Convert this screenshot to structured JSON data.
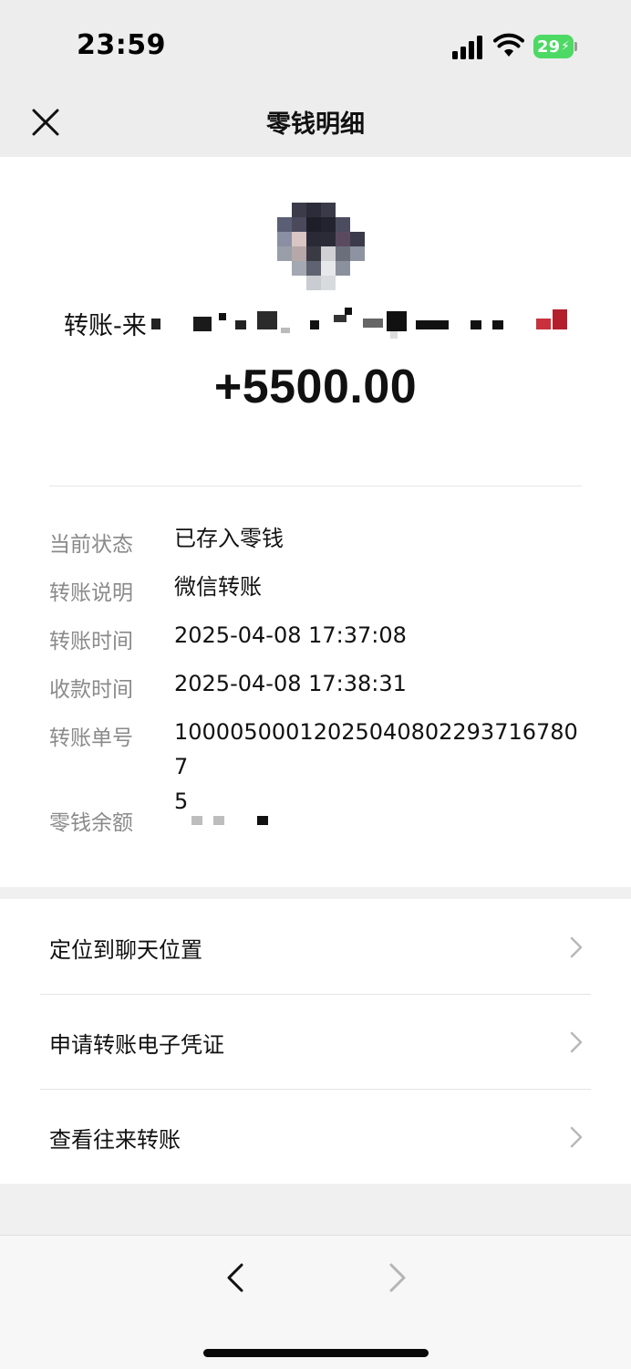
{
  "status_bar": {
    "time": "23:59",
    "battery_level": "29",
    "icons": [
      "signal-icon",
      "wifi-icon",
      "battery-icon"
    ]
  },
  "nav": {
    "title": "零钱明细",
    "close_icon": "close-icon"
  },
  "transfer": {
    "sender_prefix": "转账-来",
    "amount": "+5500.00"
  },
  "details": [
    {
      "label": "当前状态",
      "value": "已存入零钱"
    },
    {
      "label": "转账说明",
      "value": "微信转账"
    },
    {
      "label": "转账时间",
      "value": "2025-04-08 17:37:08"
    },
    {
      "label": "收款时间",
      "value": "2025-04-08 17:38:31"
    },
    {
      "label": "转账单号",
      "value": "100005000120250408022937167807\n5"
    },
    {
      "label": "零钱余额",
      "value": ""
    }
  ],
  "actions": [
    {
      "label": "定位到聊天位置"
    },
    {
      "label": "申请转账电子凭证"
    },
    {
      "label": "查看往来转账"
    }
  ],
  "colors": {
    "background": "#ededed",
    "card": "#ffffff",
    "label_gray": "#8a8a8a",
    "battery_green": "#4cd964"
  }
}
